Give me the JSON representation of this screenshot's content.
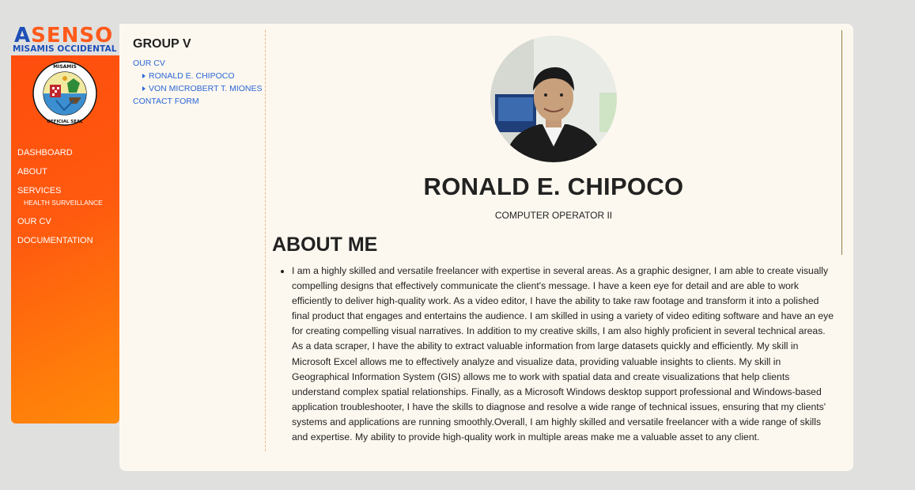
{
  "brand": {
    "logo_first": "A",
    "logo_rest": "SENSO",
    "logo_sub": "MISAMIS OCCIDENTAL",
    "seal_text": "PROVINCE OF MISAMIS OCCIDENTAL • OFFICIAL SEAL"
  },
  "sidebar": {
    "items": [
      {
        "label": "DASHBOARD"
      },
      {
        "label": "ABOUT"
      },
      {
        "label": "SERVICES"
      },
      {
        "label": "OUR CV"
      },
      {
        "label": "DOCUMENTATION"
      }
    ],
    "services_sub": "HEALTH SURVEILLANCE"
  },
  "toc": {
    "title": "GROUP V",
    "our_cv": "OUR CV",
    "members": [
      "RONALD E. CHIPOCO",
      "VON MICROBERT T. MIONES"
    ],
    "contact": "CONTACT FORM"
  },
  "profile": {
    "name": "RONALD E. CHIPOCO",
    "role": "COMPUTER OPERATOR II",
    "about_heading": "ABOUT ME",
    "about_text": "I am a highly skilled and versatile freelancer with expertise in several areas. As a graphic designer, I am able to create visually compelling designs that effectively communicate the client's message. I have a keen eye for detail and are able to work efficiently to deliver high-quality work. As a video editor, I have the ability to take raw footage and transform it into a polished final product that engages and entertains the audience. I am skilled in using a variety of video editing software and have an eye for creating compelling visual narratives. In addition to my creative skills, I am also highly proficient in several technical areas. As a data scraper, I have the ability to extract valuable information from large datasets quickly and efficiently. My skill in Microsoft Excel allows me to effectively analyze and visualize data, providing valuable insights to clients. My skill in Geographical Information System (GIS) allows me to work with spatial data and create visualizations that help clients understand complex spatial relationships. Finally, as a Microsoft Windows desktop support professional and Windows-based application troubleshooter, I have the skills to diagnose and resolve a wide range of technical issues, ensuring that my clients' systems and applications are running smoothly.Overall, I am highly skilled and versatile freelancer with a wide range of skills and expertise. My ability to provide high-quality work in multiple areas make me a valuable asset to any client."
  },
  "colors": {
    "sidebar_orange": "#ff5a0f",
    "link_blue": "#2a66d8",
    "card_bg": "#fdf8ef",
    "page_bg": "#e0e0df"
  }
}
